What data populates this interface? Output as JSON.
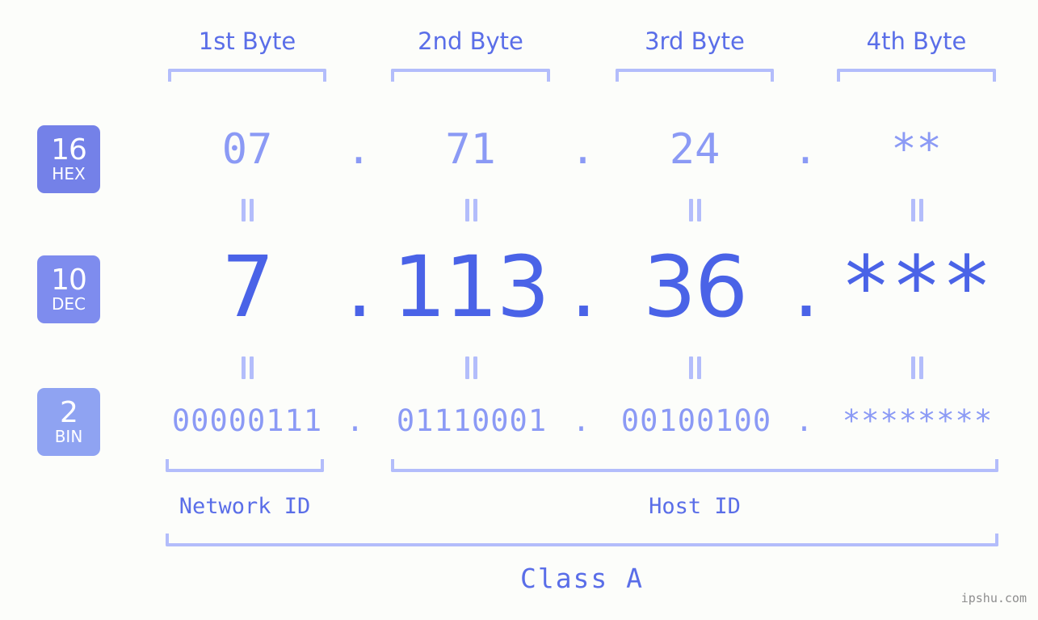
{
  "theme": {
    "background": "#fcfdfa",
    "bracket": "#b3bdfb",
    "label_blue": "#5a6ee8",
    "light_blue": "#8b9af5",
    "strong_blue": "#4a63e7",
    "badge_hex": "#7481e8",
    "badge_dec": "#7e8cee",
    "badge_bin": "#8fa3f2",
    "watermark": "#8e8e8e"
  },
  "headers": {
    "bytes": [
      {
        "label": "1st Byte"
      },
      {
        "label": "2nd Byte"
      },
      {
        "label": "3rd Byte"
      },
      {
        "label": "4th Byte"
      }
    ]
  },
  "badges": [
    {
      "num": "16",
      "base": "HEX"
    },
    {
      "num": "10",
      "base": "DEC"
    },
    {
      "num": "2",
      "base": "BIN"
    }
  ],
  "separator": ".",
  "rows": {
    "hex": {
      "base_label": "HEX",
      "base_number": "16",
      "values": [
        "07",
        "71",
        "24",
        "**"
      ]
    },
    "dec": {
      "base_label": "DEC",
      "base_number": "10",
      "values": [
        "7",
        "113",
        "36",
        "***"
      ]
    },
    "bin": {
      "base_label": "BIN",
      "base_number": "2",
      "values": [
        "00000111",
        "01110001",
        "00100100",
        "********"
      ]
    }
  },
  "segments": {
    "network_id": "Network ID",
    "host_id": "Host ID"
  },
  "class": {
    "label": "Class A"
  },
  "watermark": {
    "text": "ipshu.com"
  }
}
